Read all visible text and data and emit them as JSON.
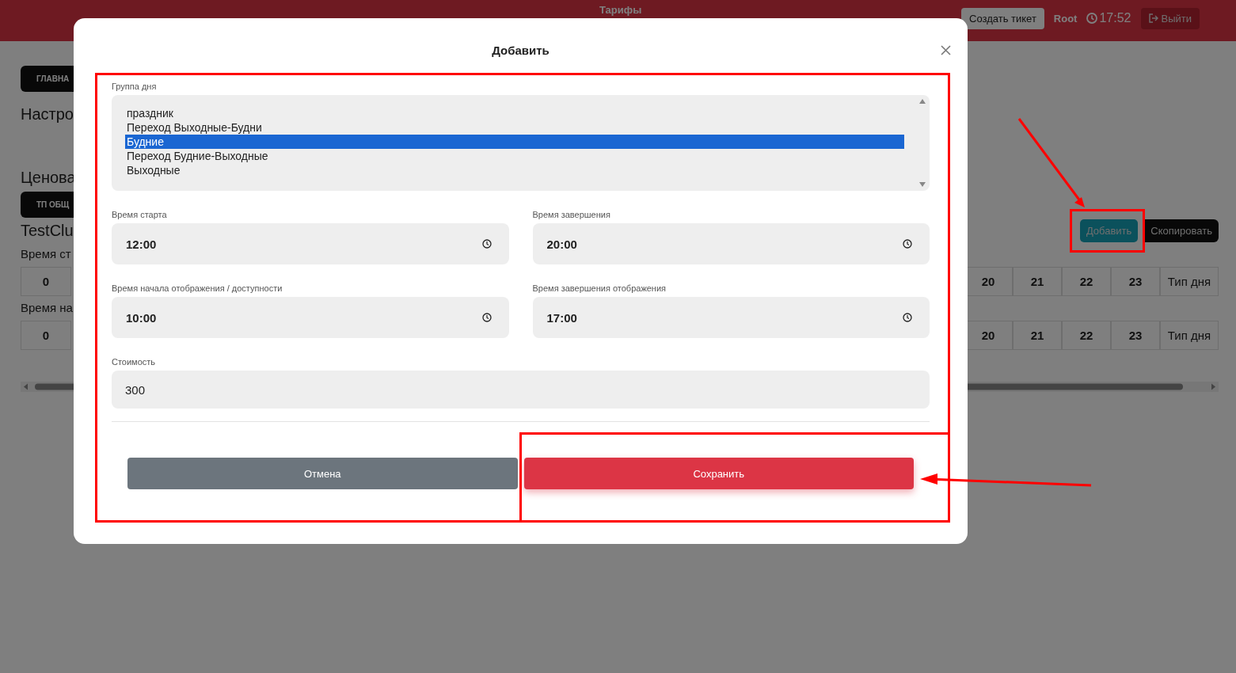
{
  "header": {
    "title": "Тарифы",
    "ticket_button": "Создать тикет",
    "user": "Root",
    "time": "17:52",
    "logout_button": "Выйти"
  },
  "page": {
    "main_tab": "ГЛАВНА",
    "settings_heading": "Настро",
    "pricing_heading": "Ценова",
    "plan_tab": "ТП ОБЩ",
    "club_name": "TestClu",
    "add_button": "Добавить",
    "copy_button": "Скопировать",
    "tables": [
      {
        "label": "Время ст",
        "first_cell": "0",
        "columns": [
          "20",
          "21",
          "22",
          "23",
          "Тип дня"
        ]
      },
      {
        "label": "Время на",
        "first_cell": "0",
        "columns": [
          "20",
          "21",
          "22",
          "23",
          "Тип дня"
        ]
      }
    ]
  },
  "modal": {
    "title": "Добавить",
    "group_label": "Группа дня",
    "options": [
      {
        "label": "праздник",
        "selected": false
      },
      {
        "label": "Переход Выходные-Будни",
        "selected": false
      },
      {
        "label": "Будние",
        "selected": true
      },
      {
        "label": "Переход Будние-Выходные",
        "selected": false
      },
      {
        "label": "Выходные",
        "selected": false
      }
    ],
    "field_rows": [
      [
        {
          "kind": "time",
          "label": "Время старта",
          "value": "12:00"
        },
        {
          "kind": "time",
          "label": "Время завершения",
          "value": "20:00"
        }
      ],
      [
        {
          "kind": "time",
          "label": "Время начала отображения / доступности",
          "value": "10:00"
        },
        {
          "kind": "time",
          "label": "Время завершения отображения",
          "value": "17:00"
        }
      ],
      [
        {
          "kind": "number",
          "label": "Стоимость",
          "value": "300"
        }
      ]
    ],
    "cancel_button": "Отмена",
    "save_button": "Сохранить"
  }
}
